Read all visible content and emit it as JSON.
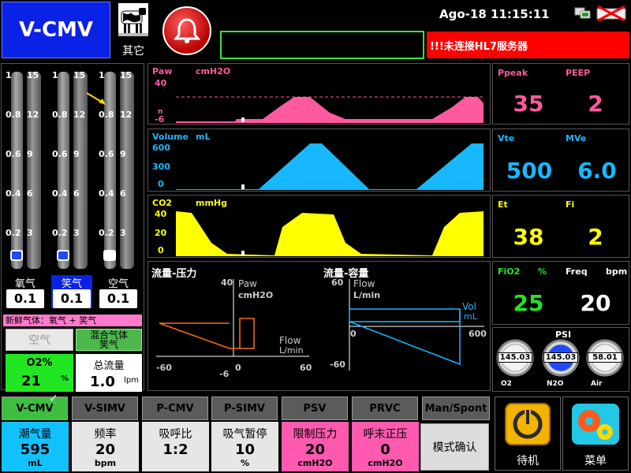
{
  "header": {
    "mode": "V-CMV",
    "animal_label": "其它",
    "datetime": "Ago-18 11:15:11",
    "alarm_message": "",
    "hl7_message": "!!!未连接HL7服务器"
  },
  "flowmeters": {
    "tubes": [
      {
        "name": "氧气",
        "value": "0.1",
        "color": "#1f4bff",
        "label_bg": "#000"
      },
      {
        "name": "笑气",
        "value": "0.1",
        "color": "#1f4bff",
        "label_bg": "#0a22e6"
      },
      {
        "name": "空气",
        "value": "0.1",
        "color": "#ffffff",
        "label_bg": "#000"
      }
    ],
    "left_ticks": [
      "1",
      "0.8",
      "0.6",
      "0.4",
      "0.2"
    ],
    "right_ticks": [
      "15",
      "12",
      "9",
      "6",
      "3"
    ],
    "fresh_gas_title": "新鲜气体：氧气 + 笑气",
    "air_button": "空气",
    "mix_button": "混合气体\n笑气",
    "o2_percent_label": "O2%",
    "o2_percent_value": "21",
    "o2_percent_unit": "%",
    "total_flow_label": "总流量",
    "total_flow_value": "1.0",
    "total_flow_unit": "lpm"
  },
  "waves": {
    "paw": {
      "name": "Paw",
      "unit": "cmH2O",
      "max": "40",
      "min_a": "n",
      "min_b": "-6",
      "color": "#ff5aa0"
    },
    "volume": {
      "name": "Volume",
      "unit": "mL",
      "max": "600",
      "mid": "300",
      "min": "0",
      "color": "#18b8ff"
    },
    "co2": {
      "name": "CO2",
      "unit": "mmHg",
      "max": "40",
      "mid": "20",
      "min": "0",
      "color": "#ffff00"
    }
  },
  "numerics": {
    "ppeak": {
      "label": "Ppeak",
      "value": "35"
    },
    "peep": {
      "label": "PEEP",
      "value": "2"
    },
    "vte": {
      "label": "Vte",
      "value": "500"
    },
    "mve": {
      "label": "MVe",
      "value": "6.0"
    },
    "et": {
      "label": "Et",
      "value": "38"
    },
    "fi": {
      "label": "Fi",
      "value": "2"
    },
    "fio2": {
      "label": "FiO2",
      "unit": "%",
      "value": "25"
    },
    "freq": {
      "label": "Freq",
      "unit": "bpm",
      "value": "20"
    }
  },
  "loops": {
    "flow_pressure": {
      "title": "流量-压力",
      "y_top": "40",
      "y_label": "Paw",
      "y_unit": "cmH2O",
      "x_label": "Flow",
      "x_unit": "L/min",
      "x_left": "-60",
      "x_mid_a": "-6",
      "x_mid_b": "0",
      "x_right": "60"
    },
    "flow_volume": {
      "title": "流量-容量",
      "y_top": "60",
      "y_label": "Flow",
      "y_unit": "L/min",
      "x_zero": "0",
      "x_right": "600",
      "x_label": "Vol",
      "x_unit": "mL",
      "y_bottom": "-60"
    }
  },
  "gauges": {
    "title": "PSI",
    "items": [
      {
        "name": "O2",
        "value": "145.03",
        "color": "#f2f2f2"
      },
      {
        "name": "N2O",
        "value": "145.03",
        "color": "#1f4bff"
      },
      {
        "name": "Air",
        "value": "58.01",
        "color": "#f2f2f2"
      }
    ]
  },
  "modes": [
    "V-CMV",
    "V-SIMV",
    "P-CMV",
    "P-SIMV",
    "PSV",
    "PRVC",
    "Man/Spont"
  ],
  "params": [
    {
      "name": "潮气量",
      "value": "595",
      "unit": "mL",
      "bg": "#12c2ff"
    },
    {
      "name": "频率",
      "value": "20",
      "unit": "bpm",
      "bg": "#e6e6e6"
    },
    {
      "name": "吸呼比",
      "value": "1:2",
      "unit": "",
      "bg": "#e6e6e6"
    },
    {
      "name": "吸气暂停",
      "value": "10",
      "unit": "%",
      "bg": "#e6e6e6"
    },
    {
      "name": "限制压力",
      "value": "20",
      "unit": "cmH2O",
      "bg": "#ff5ab0"
    },
    {
      "name": "呼末正压",
      "value": "0",
      "unit": "cmH2O",
      "bg": "#ff5ab0"
    }
  ],
  "confirm_label": "模式确认",
  "standby_label": "待机",
  "menu_label": "菜单"
}
